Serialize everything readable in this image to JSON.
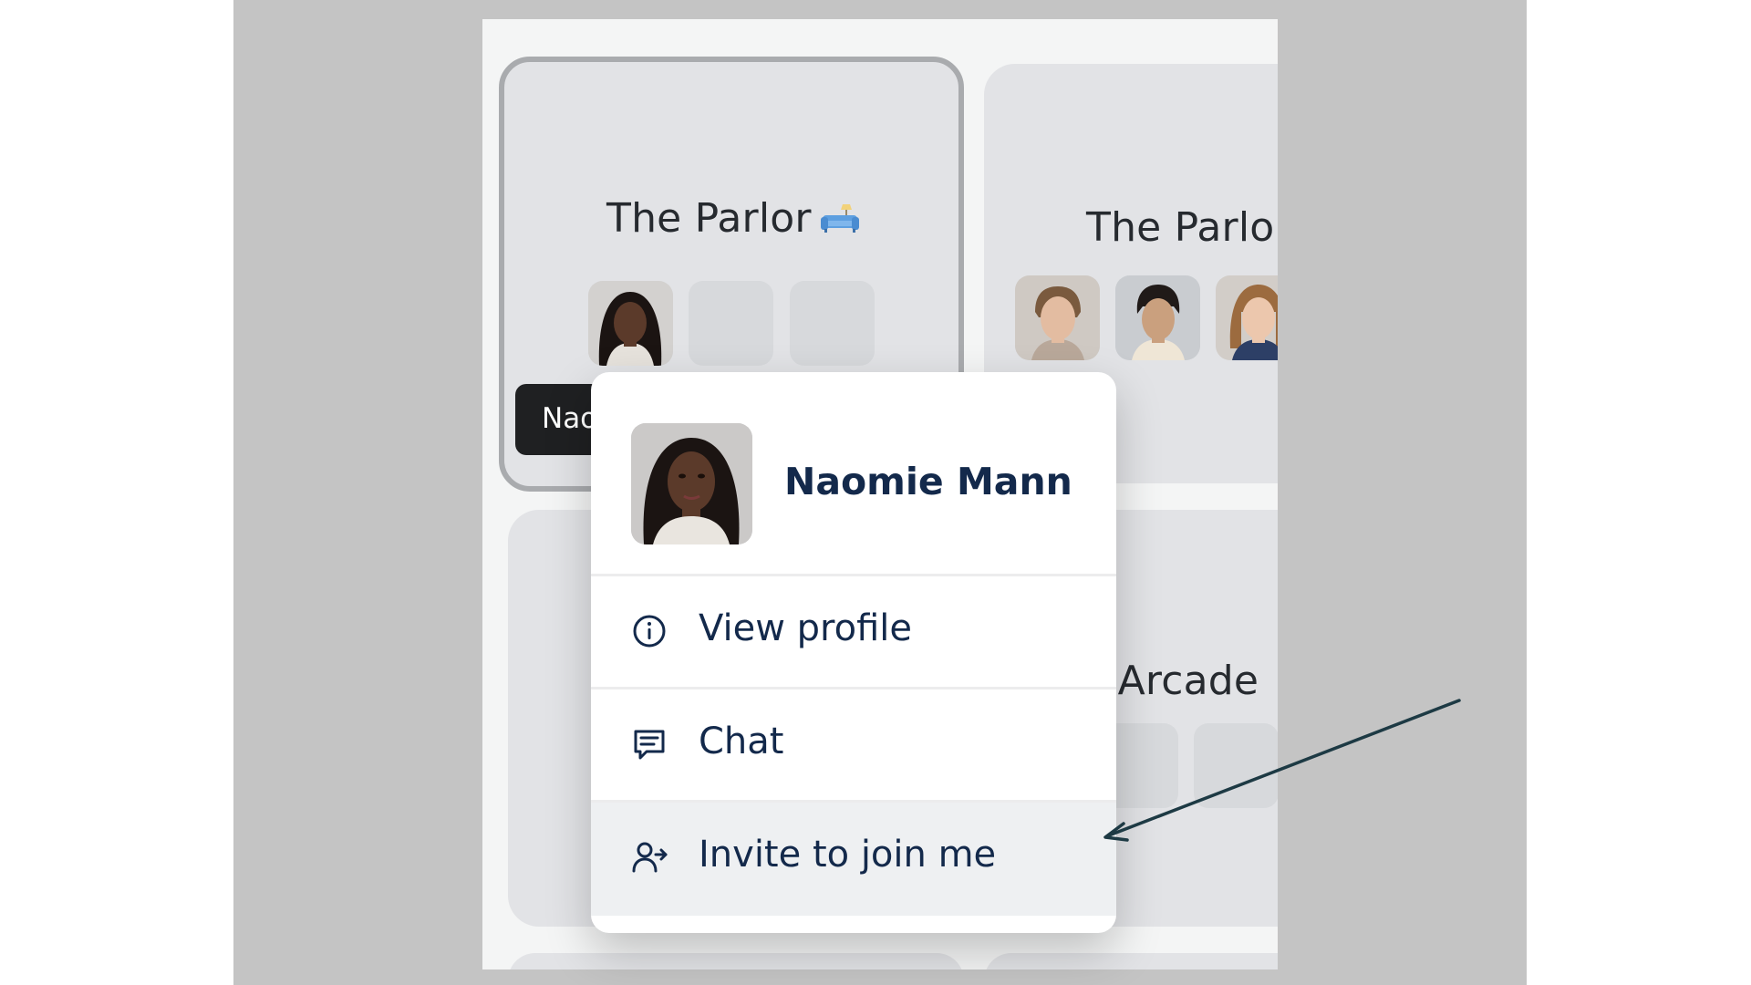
{
  "rooms": [
    {
      "title": "The Parlor",
      "emoji": "couch-lamp-icon"
    },
    {
      "title": "The Parlor"
    },
    {
      "title": "The Arcade"
    }
  ],
  "hover_tag": {
    "name": "Naomie Mann"
  },
  "context_menu": {
    "user_name": "Naomie Mann",
    "items": [
      {
        "label": "View profile",
        "icon": "info-icon"
      },
      {
        "label": "Chat",
        "icon": "chat-icon"
      },
      {
        "label": "Invite to join me",
        "icon": "invite-user-icon"
      }
    ]
  },
  "colors": {
    "overlay": "#c4c4c4",
    "card": "#e2e3e6",
    "menu_text": "#13294b",
    "annotation_arrow": "#1d3a44"
  }
}
